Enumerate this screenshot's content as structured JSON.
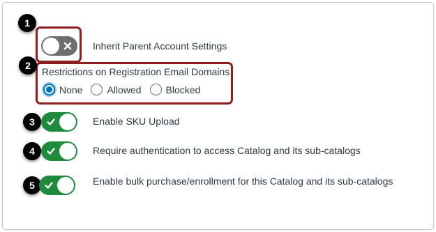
{
  "settings": {
    "inherit": {
      "label": "Inherit Parent Account Settings",
      "enabled": false
    },
    "restrictions": {
      "title": "Restrictions on Registration Email Domains",
      "options": [
        "None",
        "Allowed",
        "Blocked"
      ],
      "selected": "None"
    },
    "sku": {
      "label": "Enable SKU Upload",
      "enabled": true
    },
    "auth": {
      "label": "Require authentication to access Catalog and its sub-catalogs",
      "enabled": true
    },
    "bulk": {
      "label": "Enable bulk purchase/enrollment for this Catalog and its sub-catalogs",
      "enabled": true
    }
  },
  "callouts": [
    "1",
    "2",
    "3",
    "4",
    "5"
  ],
  "colors": {
    "toggle_on": "#1e8a3c",
    "toggle_off": "#6e6e6e",
    "radio_selected": "#0374b5",
    "highlight": "#8e1d1d"
  }
}
